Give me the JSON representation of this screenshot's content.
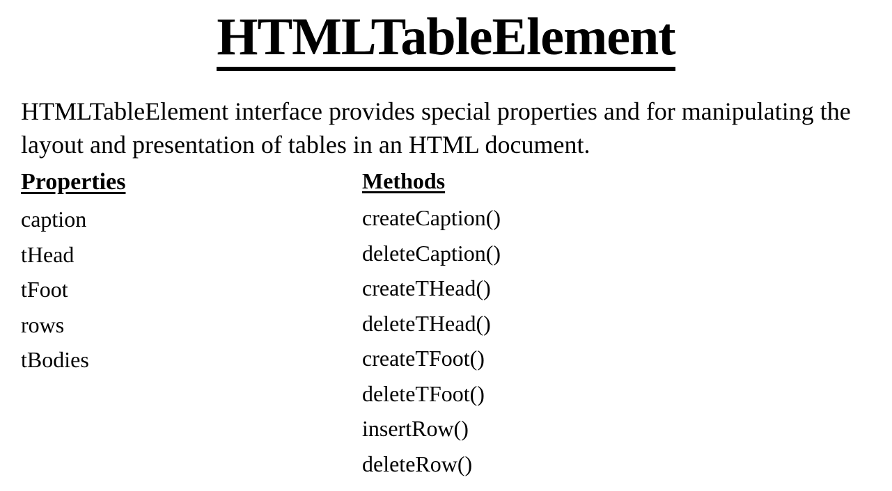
{
  "title": "HTMLTableElement",
  "description": "HTMLTableElement interface provides special properties and for manipulating the layout and presentation of tables in an HTML document.",
  "properties": {
    "heading": "Properties",
    "items": [
      "caption",
      "tHead",
      "tFoot",
      "rows",
      "tBodies"
    ]
  },
  "methods": {
    "heading": "Methods",
    "items": [
      "createCaption()",
      "deleteCaption()",
      "createTHead()",
      "deleteTHead()",
      "createTFoot()",
      "deleteTFoot()",
      "insertRow()",
      "deleteRow()"
    ]
  }
}
